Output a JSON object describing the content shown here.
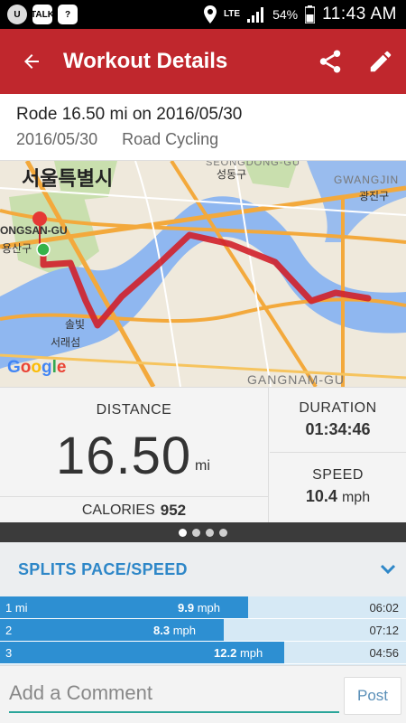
{
  "status_bar": {
    "app_icons": [
      "U",
      "TALK",
      "?"
    ],
    "network": "LTE",
    "battery": "54%",
    "time": "11:43 AM"
  },
  "app_bar": {
    "title": "Workout Details",
    "icons": [
      "back-arrow-icon",
      "share-icon",
      "edit-icon"
    ]
  },
  "workout": {
    "title": "Rode 16.50 mi on 2016/05/30",
    "date": "2016/05/30",
    "activity": "Road Cycling"
  },
  "map": {
    "labels": {
      "seoul": "서울특별시",
      "yongsan": "ONGSAN-GU",
      "yongsan_kr": "용산구",
      "seongdong_en": "SEONGDONG-GU",
      "seongdong_kr": "성동구",
      "gwangjin_en": "GWANGJIN",
      "gwangjin_kr": "광진구",
      "solbit": "솔빛",
      "seorae": "서래섬",
      "gangnam": "GANGNAM-GU"
    },
    "attribution": "Google",
    "colors": {
      "route": "#d0202a",
      "start": "#34b34a",
      "end_pin": "#e53935",
      "water": "#8fb7f0",
      "roads": "#f3a93c"
    }
  },
  "stats": {
    "distance_label": "DISTANCE",
    "distance_value": "16.50",
    "distance_unit": "mi",
    "calories_label": "CALORIES",
    "calories_value": "952",
    "duration_label": "DURATION",
    "duration_value": "01:34:46",
    "speed_label": "SPEED",
    "speed_value": "10.4",
    "speed_unit": "mph"
  },
  "pager": {
    "pages": 4,
    "active": 0
  },
  "splits": {
    "title": "SPLITS PACE/SPEED",
    "rows": [
      {
        "label": "1 mi",
        "speed": "9.9",
        "unit": "mph",
        "time": "06:02",
        "fill_fraction": 0.61
      },
      {
        "label": "2",
        "speed": "8.3",
        "unit": "mph",
        "time": "07:12",
        "fill_fraction": 0.55
      },
      {
        "label": "3",
        "speed": "12.2",
        "unit": "mph",
        "time": "04:56",
        "fill_fraction": 0.7
      }
    ]
  },
  "comment": {
    "placeholder": "Add a Comment",
    "post_label": "Post"
  }
}
